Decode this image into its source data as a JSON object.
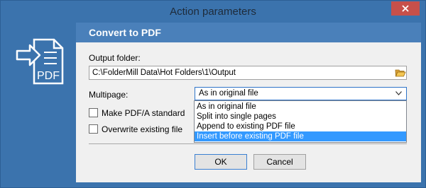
{
  "window": {
    "title": "Action parameters",
    "close_icon": "close-icon"
  },
  "sidebar": {
    "icon": "convert-to-pdf-icon",
    "icon_text": "PDF"
  },
  "header": {
    "title": "Convert to PDF"
  },
  "output_folder": {
    "label": "Output folder:",
    "value": "C:\\FolderMill Data\\Hot Folders\\1\\Output",
    "browse_icon": "folder-open-icon"
  },
  "multipage": {
    "label": "Multipage:",
    "selected": "As in original file",
    "options": [
      "As in original file",
      "Split into single pages",
      "Append to existing PDF file",
      "Insert before existing PDF file"
    ],
    "highlighted_index": 3
  },
  "checkboxes": {
    "pdfa_label": "Make PDF/A standard",
    "pdfa_checked": false,
    "overwrite_label": "Overwrite existing file",
    "overwrite_checked": false
  },
  "buttons": {
    "ok_label": "OK",
    "cancel_label": "Cancel"
  },
  "colors": {
    "frame": "#3b73ad",
    "header_band": "#4a80ba",
    "highlight": "#3399ff",
    "close": "#c7504a"
  }
}
